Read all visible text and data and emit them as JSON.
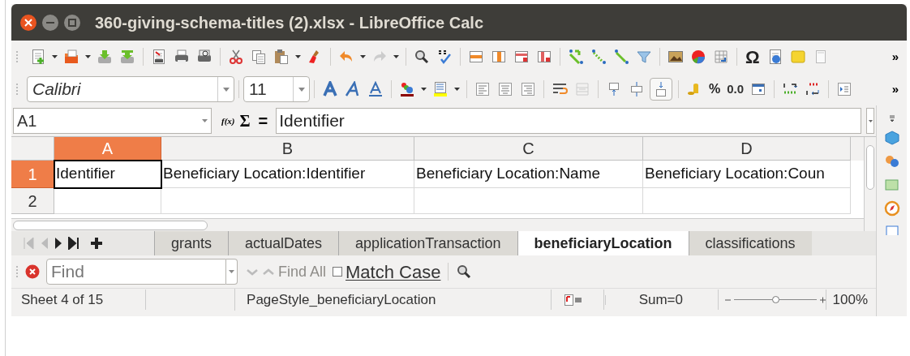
{
  "window": {
    "title": "360-giving-schema-titles (2).xlsx - LibreOffice Calc"
  },
  "standard_toolbar": {
    "special_character": "Ω",
    "overflow": "»"
  },
  "formatting_toolbar": {
    "font_name": "Calibri",
    "font_size": "11",
    "percent": "%",
    "decimal": "0.0",
    "overflow": "»"
  },
  "formula_bar": {
    "cell_reference": "A1",
    "function_wizard": "f(x)",
    "sum": "Σ",
    "equals": "=",
    "content": "Identifier"
  },
  "columns": [
    {
      "label": "A",
      "selected": true
    },
    {
      "label": "B",
      "selected": false
    },
    {
      "label": "C",
      "selected": false
    },
    {
      "label": "D",
      "selected": false
    }
  ],
  "rows": [
    {
      "label": "1",
      "selected": true,
      "cells": [
        "Identifier",
        "Beneficiary Location:Identifier",
        "Beneficiary Location:Name",
        "Beneficiary Location:Coun"
      ]
    },
    {
      "label": "2",
      "selected": false,
      "cells": []
    }
  ],
  "sheet_tabs": [
    {
      "label": "grants",
      "selected": false
    },
    {
      "label": "actualDates",
      "selected": false
    },
    {
      "label": "applicationTransaction",
      "selected": false
    },
    {
      "label": "beneficiaryLocation",
      "selected": true
    },
    {
      "label": "classifications",
      "selected": false
    }
  ],
  "find_bar": {
    "placeholder": "Find",
    "find_all": "Find All",
    "find_all_disabled": true,
    "match_case": "Match Case",
    "match_case_checked": false
  },
  "status_bar": {
    "sheet": "Sheet 4 of 15",
    "page_style": "PageStyle_beneficiaryLocation",
    "sum": "Sum=0",
    "zoom": {
      "level": 0.5
    },
    "zoom_percent": "100%"
  }
}
